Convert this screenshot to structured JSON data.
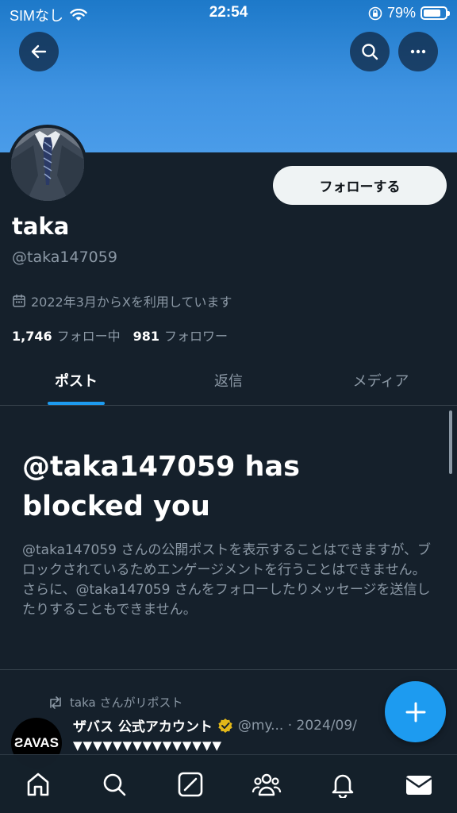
{
  "status_bar": {
    "carrier": "SIMなし",
    "time": "22:54",
    "battery": "79%",
    "battery_level": 0.79
  },
  "profile": {
    "display_name": "taka",
    "handle": "@taka147059",
    "joined": "2022年3月からXを利用しています",
    "following_count": "1,746",
    "following_label": "フォロー中",
    "followers_count": "981",
    "followers_label": "フォロワー",
    "follow_button": "フォローする"
  },
  "tabs": [
    {
      "label": "ポスト",
      "active": true
    },
    {
      "label": "返信",
      "active": false
    },
    {
      "label": "メディア",
      "active": false
    }
  ],
  "blocked": {
    "title": "@taka147059 has blocked you",
    "description": "@taka147059 さんの公開ポストを表示することはできますが、ブロックされているためエンゲージメントを行うことはできません。さらに、@taka147059 さんをフォローしたりメッセージを送信したりすることもできません。"
  },
  "tweet": {
    "repost_label": "taka さんがリポスト",
    "author": "ザバス 公式アカウント",
    "meta": "@my... · 2024/09/",
    "avatar_text": "ƧAVAS",
    "body": "▼▼▼▼▼▼▼▼▼▼▼▼▼▼▼"
  },
  "icons": {
    "back": "arrow-left-icon",
    "search": "search-icon",
    "more": "more-icon",
    "calendar": "calendar-icon",
    "repost": "repost-icon",
    "verified": "verified-badge-icon",
    "compose": "plus-icon",
    "nav": [
      "home-icon",
      "search-icon",
      "grok-icon",
      "communities-icon",
      "bell-icon",
      "mail-icon"
    ]
  },
  "colors": {
    "accent": "#1d9bf0",
    "background": "#15202b",
    "verified": "#e2b719"
  }
}
